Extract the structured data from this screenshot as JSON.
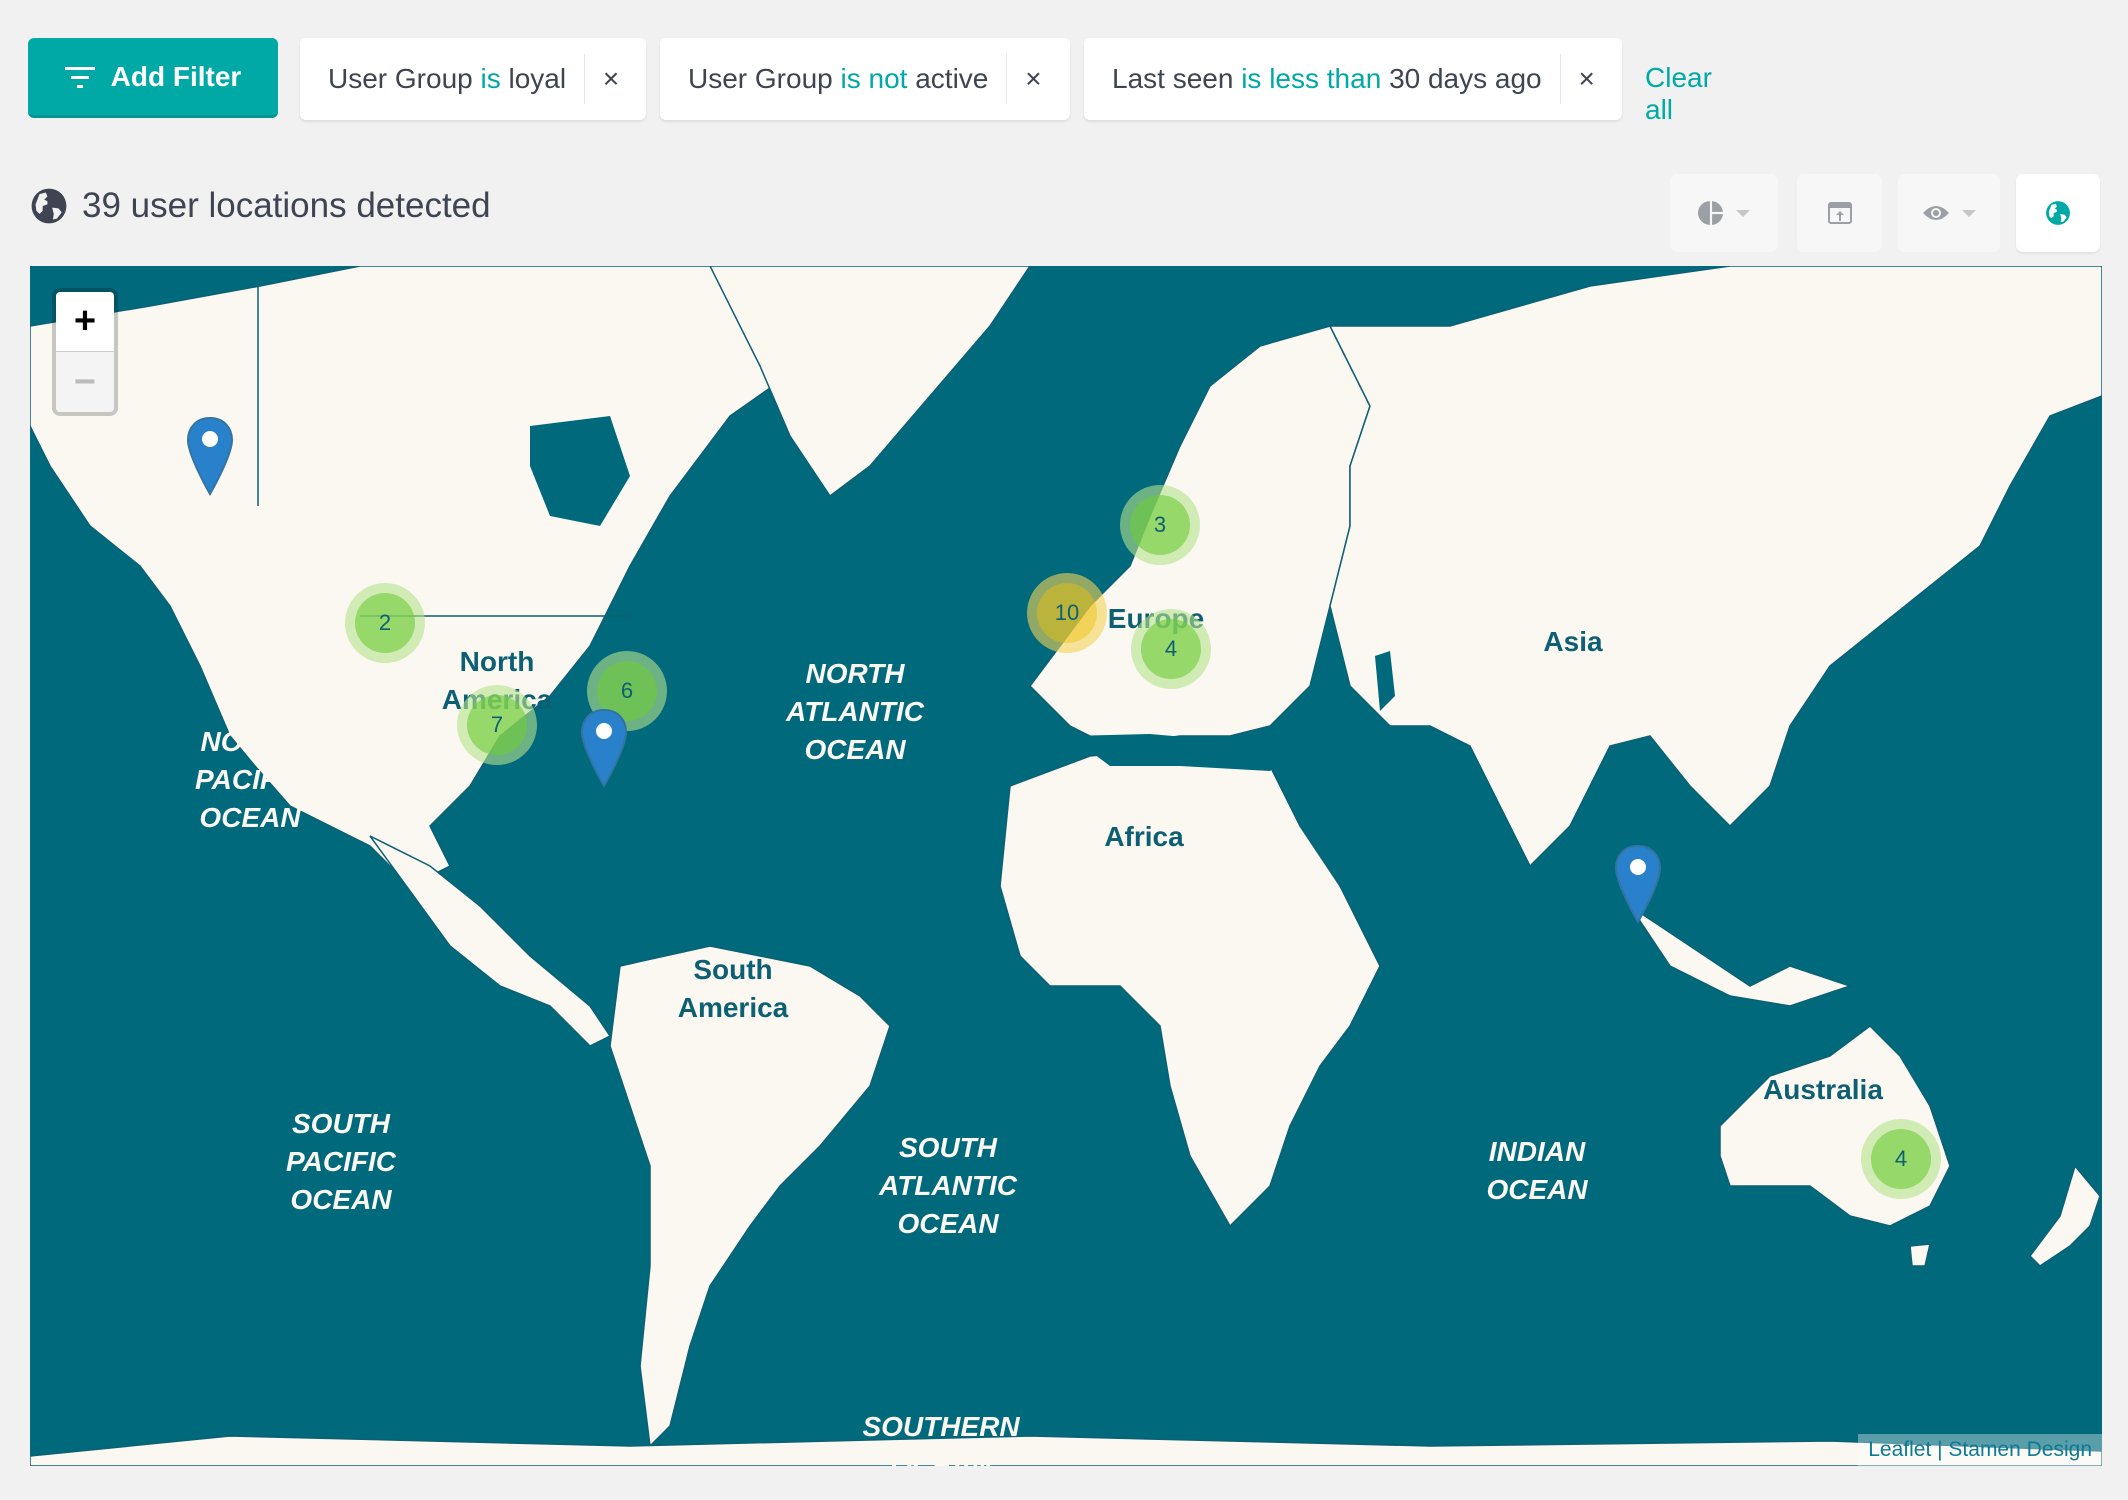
{
  "filter_bar": {
    "add_filter_label": "Add Filter",
    "chips": [
      {
        "field": "User Group",
        "operator": "is",
        "value": "loyal"
      },
      {
        "field": "User Group",
        "operator": "is not",
        "value": "active"
      },
      {
        "field": "Last seen",
        "operator": "is less than",
        "value": "30 days ago"
      }
    ],
    "remove_glyph": "×",
    "clear_all_label": "Clear all"
  },
  "header": {
    "title": "39 user locations detected",
    "icon": "globe-icon"
  },
  "toolbar": {
    "buttons": [
      {
        "icon": "pie-chart-icon",
        "has_dropdown": true,
        "active": false
      },
      {
        "icon": "export-icon",
        "has_dropdown": false,
        "active": false
      },
      {
        "icon": "eye-icon",
        "has_dropdown": true,
        "active": false
      },
      {
        "icon": "globe-icon",
        "has_dropdown": false,
        "active": true
      }
    ]
  },
  "colors": {
    "accent": "#00a9a5",
    "ocean": "#006a7c",
    "land": "#fbf8f2",
    "text": "#3e4452",
    "pin": "#2a81cb"
  },
  "map": {
    "zoom_in_label": "+",
    "zoom_out_label": "−",
    "continent_labels": [
      "North\nAmerica",
      "South\nAmerica",
      "Europe",
      "Africa",
      "Asia",
      "Australia"
    ],
    "ocean_labels": [
      "NORTH\nPACIFIC\nOCEAN",
      "NORTH\nATLANTIC\nOCEAN",
      "SOUTH\nPACIFIC\nOCEAN",
      "SOUTH\nATLANTIC\nOCEAN",
      "INDIAN\nOCEAN",
      "SOUTHERN\nOCEAN"
    ],
    "clusters": [
      {
        "count": "2",
        "region": "Pacific Northwest",
        "size": "small"
      },
      {
        "count": "7",
        "region": "Texas",
        "size": "small"
      },
      {
        "count": "6",
        "region": "US East Coast",
        "size": "small"
      },
      {
        "count": "3",
        "region": "Scandinavia",
        "size": "small"
      },
      {
        "count": "10",
        "region": "Western Europe",
        "size": "medium"
      },
      {
        "count": "4",
        "region": "Central Europe",
        "size": "small"
      },
      {
        "count": "4",
        "region": "South-East Australia",
        "size": "small"
      }
    ],
    "pins": [
      {
        "region": "Alaska"
      },
      {
        "region": "Florida"
      },
      {
        "region": "Malaysia"
      }
    ],
    "attribution": {
      "leaflet": "Leaflet",
      "separator": " | ",
      "tiles": "Stamen Design"
    }
  }
}
